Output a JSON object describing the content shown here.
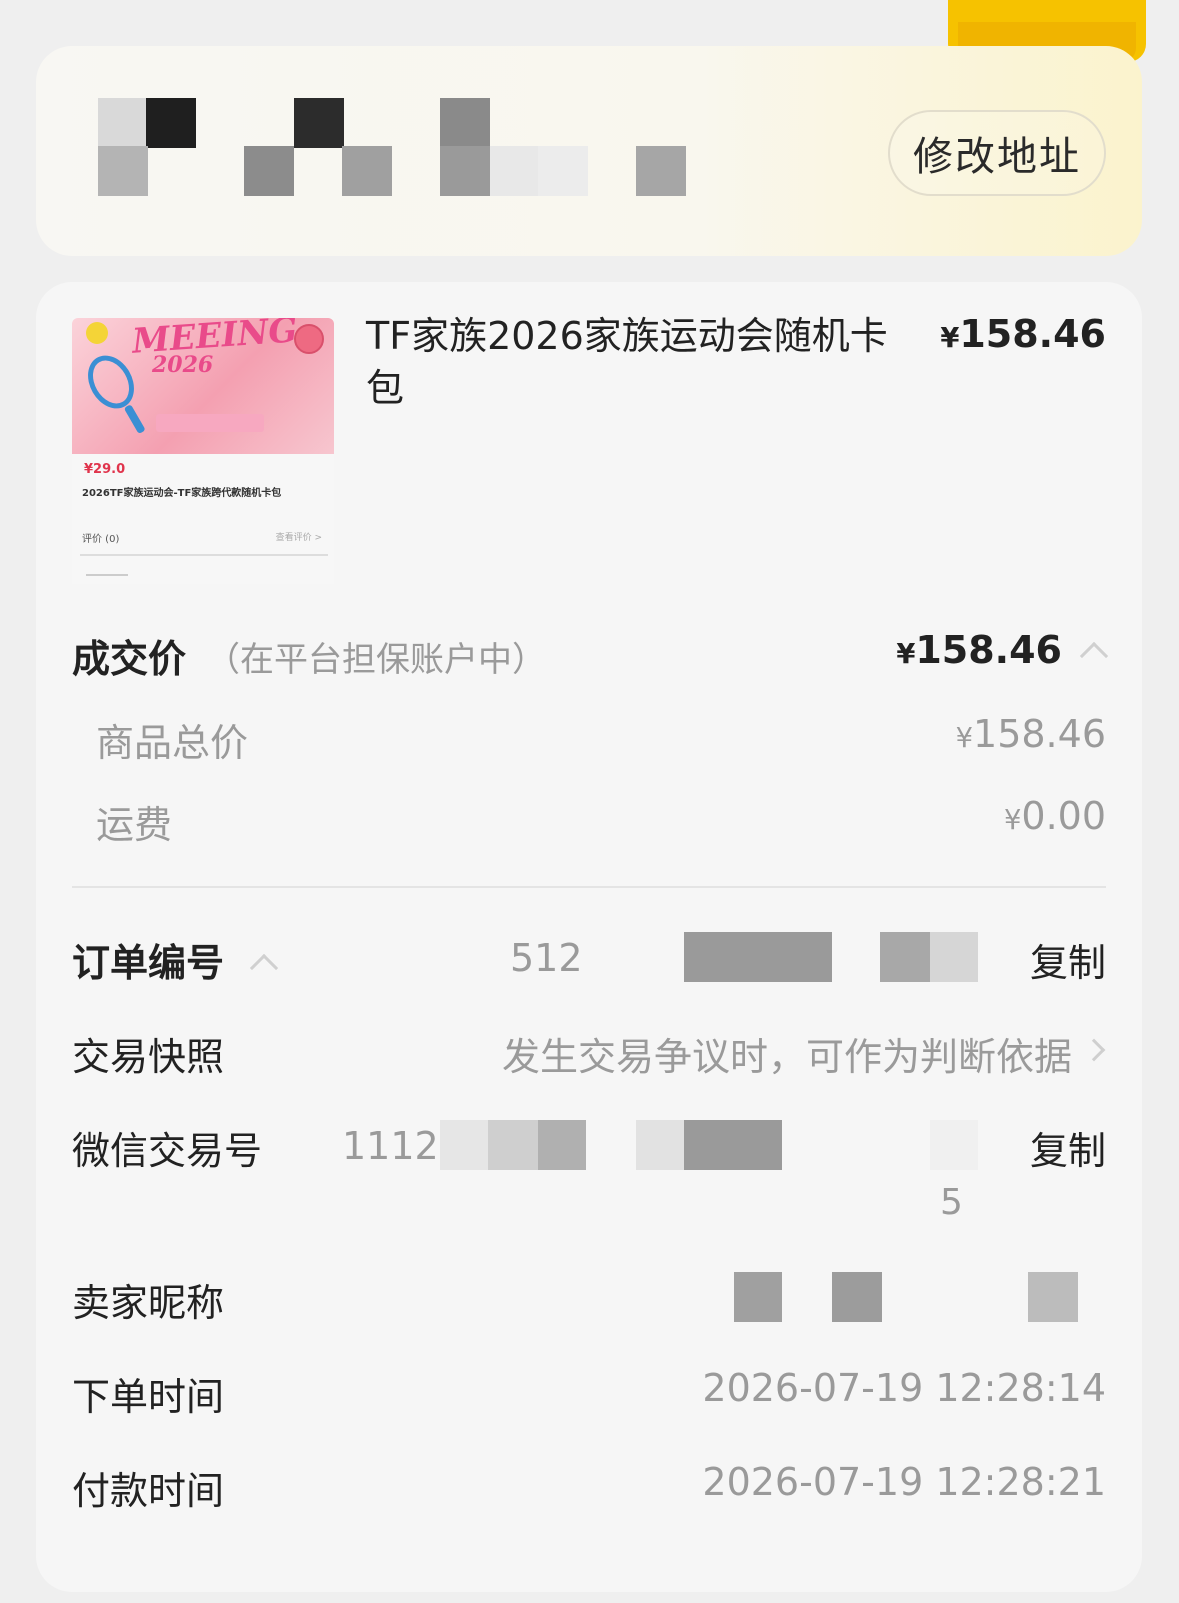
{
  "address": {
    "edit_label": "修改地址"
  },
  "product": {
    "name": "TF家族2026家族运动会随机卡包",
    "price": "158.46",
    "currency": "¥",
    "thumb": {
      "headline": "MEEING",
      "year": "2026",
      "price": "¥29.0",
      "title": "2026TF家族运动会-TF家族跨代款随机卡包",
      "review": "评价 (0)",
      "review_link": "查看评价 >"
    }
  },
  "deal": {
    "label": "成交价",
    "note": "（在平台担保账户中）",
    "amount": "158.46",
    "rows": [
      {
        "label": "商品总价",
        "value": "158.46"
      },
      {
        "label": "运费",
        "value": "0.00"
      }
    ]
  },
  "info": {
    "order_no_label": "订单编号",
    "order_no_visible": "512",
    "copy_label": "复制",
    "snapshot_label": "交易快照",
    "snapshot_hint": "发生交易争议时，可作为判断依据",
    "wechat_label": "微信交易号",
    "wechat_visible": "11120",
    "wechat_tail": "5",
    "seller_label": "卖家昵称",
    "order_time_label": "下单时间",
    "order_time": "2026-07-19 12:28:14",
    "pay_time_label": "付款时间",
    "pay_time": "2026-07-19 12:28:21"
  },
  "colors": {
    "accent_yellow": "#f6c200",
    "text_primary": "#222222",
    "text_secondary": "#9a9a9a",
    "card_bg": "#f6f6f6",
    "page_bg": "#efefef"
  }
}
